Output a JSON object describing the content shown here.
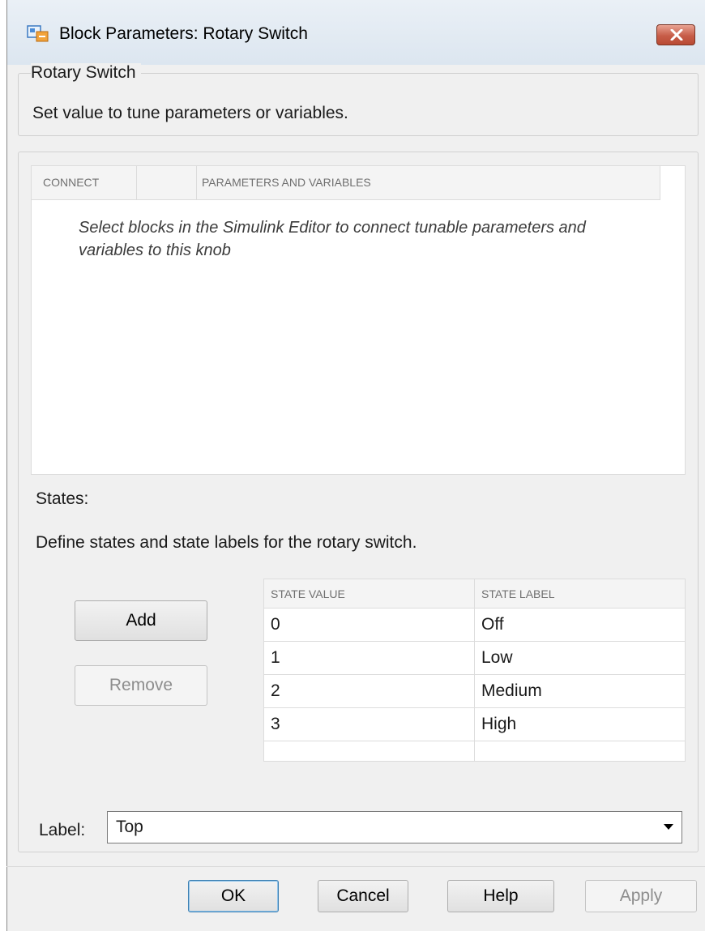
{
  "window": {
    "title": "Block Parameters: Rotary Switch",
    "icon": "simulink-block-icon",
    "close_icon": "close-icon"
  },
  "header": {
    "group_title": "Rotary Switch",
    "description": "Set value to tune parameters or variables."
  },
  "connect_table": {
    "columns": [
      "CONNECT",
      "",
      "PARAMETERS AND VARIABLES"
    ],
    "empty_message": "Select blocks in the Simulink Editor to connect tunable parameters and variables to this knob"
  },
  "states": {
    "label": "States:",
    "description": "Define states and state labels for the rotary switch.",
    "add_label": "Add",
    "remove_label": "Remove",
    "columns": [
      "STATE VALUE",
      "STATE LABEL"
    ],
    "rows": [
      {
        "value": "0",
        "label": "Off"
      },
      {
        "value": "1",
        "label": "Low"
      },
      {
        "value": "2",
        "label": "Medium"
      },
      {
        "value": "3",
        "label": "High"
      }
    ]
  },
  "label_field": {
    "label": "Label:",
    "selected": "Top"
  },
  "buttons": {
    "ok": "OK",
    "cancel": "Cancel",
    "help": "Help",
    "apply": "Apply"
  }
}
